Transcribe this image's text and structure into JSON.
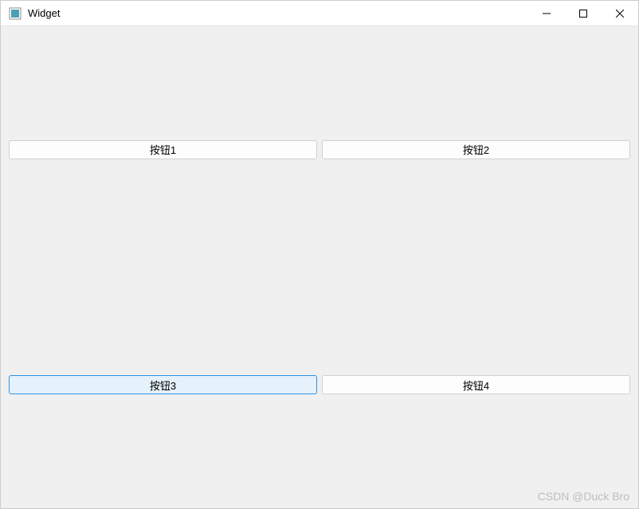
{
  "window": {
    "title": "Widget"
  },
  "buttons": {
    "b1": "按钮1",
    "b2": "按钮2",
    "b3": "按钮3",
    "b4": "按钮4"
  },
  "watermark": "CSDN @Duck Bro"
}
